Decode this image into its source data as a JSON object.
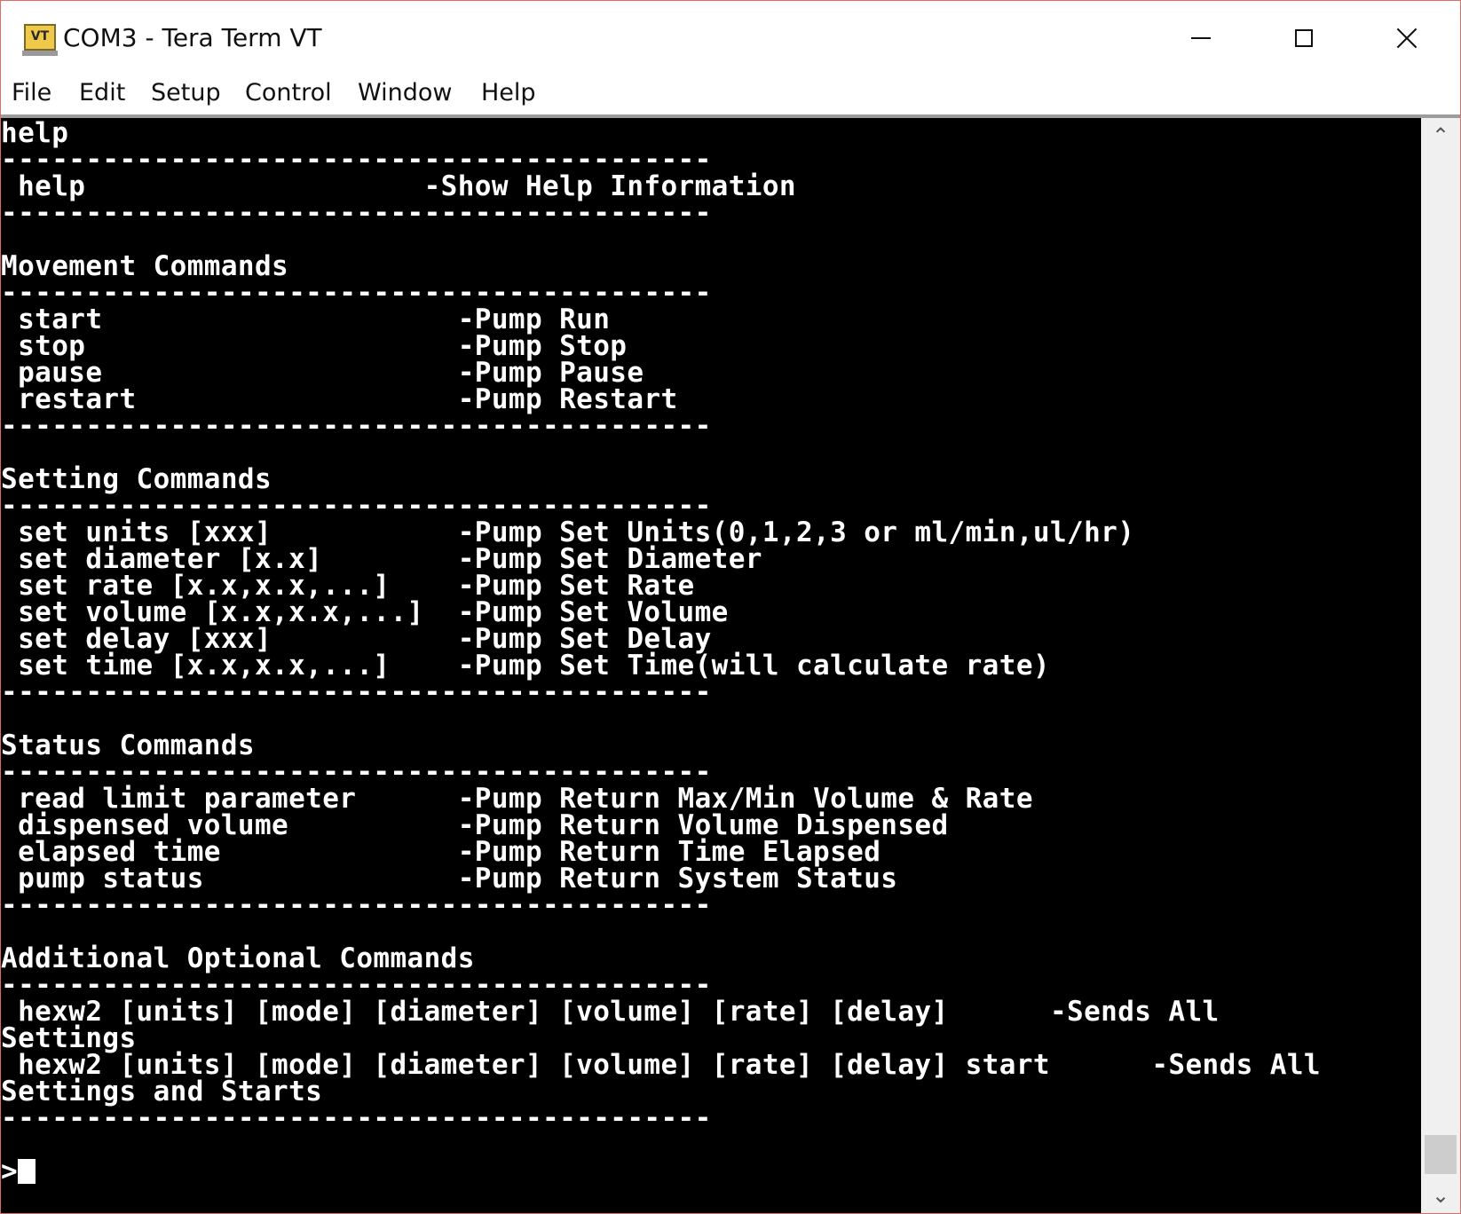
{
  "window": {
    "title": "COM3 - Tera Term VT",
    "icon_label": "VT"
  },
  "menu": {
    "items": [
      "File",
      "Edit",
      "Setup",
      "Control",
      "Window",
      "Help"
    ]
  },
  "terminal": {
    "lines": [
      "help",
      "------------------------------------------",
      " help                    -Show Help Information",
      "------------------------------------------",
      "",
      "Movement Commands",
      "------------------------------------------",
      " start                     -Pump Run",
      " stop                      -Pump Stop",
      " pause                     -Pump Pause",
      " restart                   -Pump Restart",
      "------------------------------------------",
      "",
      "Setting Commands",
      "------------------------------------------",
      " set units [xxx]           -Pump Set Units(0,1,2,3 or ml/min,ul/hr)",
      " set diameter [x.x]        -Pump Set Diameter",
      " set rate [x.x,x.x,...]    -Pump Set Rate",
      " set volume [x.x,x.x,...]  -Pump Set Volume",
      " set delay [xxx]           -Pump Set Delay",
      " set time [x.x,x.x,...]    -Pump Set Time(will calculate rate)",
      "------------------------------------------",
      "",
      "Status Commands",
      "------------------------------------------",
      " read limit parameter      -Pump Return Max/Min Volume & Rate",
      " dispensed volume          -Pump Return Volume Dispensed",
      " elapsed time              -Pump Return Time Elapsed",
      " pump status               -Pump Return System Status",
      "------------------------------------------",
      "",
      "Additional Optional Commands",
      "------------------------------------------",
      " hexw2 [units] [mode] [diameter] [volume] [rate] [delay]      -Sends All",
      "Settings",
      " hexw2 [units] [mode] [diameter] [volume] [rate] [delay] start      -Sends All",
      "Settings and Starts",
      "------------------------------------------",
      ""
    ],
    "prompt": ">"
  },
  "icons": {
    "minimize": "minimize-icon",
    "maximize": "maximize-icon",
    "close": "close-icon",
    "scroll_up": "chevron-up-icon",
    "scroll_down": "chevron-down-icon"
  }
}
